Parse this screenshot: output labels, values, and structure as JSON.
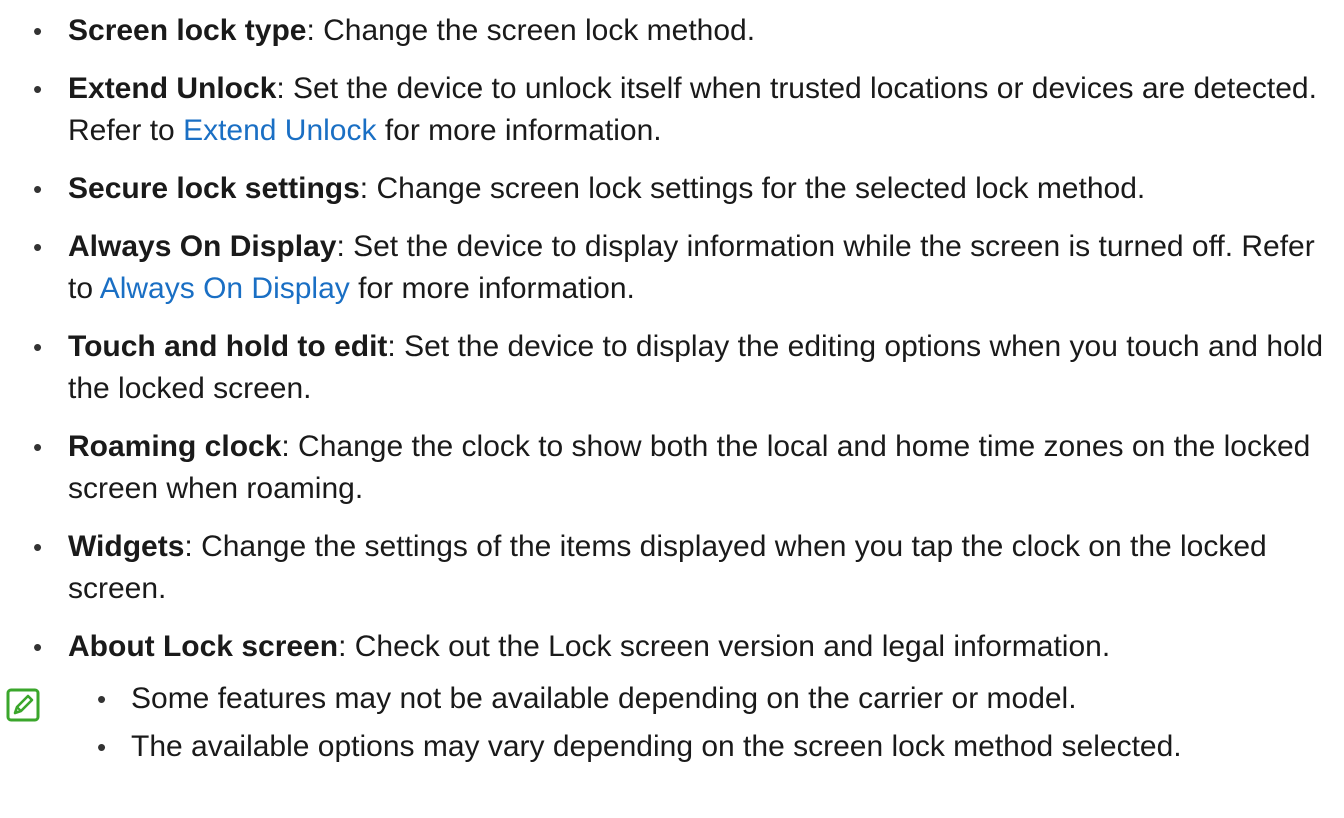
{
  "bullets": [
    {
      "term": "Screen lock type",
      "pre": ": Change the screen lock method.",
      "link": "",
      "post": ""
    },
    {
      "term": "Extend Unlock",
      "pre": ": Set the device to unlock itself when trusted locations or devices are detected. Refer to ",
      "link": "Extend Unlock",
      "post": " for more information."
    },
    {
      "term": "Secure lock settings",
      "pre": ": Change screen lock settings for the selected lock method.",
      "link": "",
      "post": ""
    },
    {
      "term": "Always On Display",
      "pre": ": Set the device to display information while the screen is turned off. Refer to ",
      "link": "Always On Display",
      "post": " for more information."
    },
    {
      "term": "Touch and hold to edit",
      "pre": ": Set the device to display the editing options when you touch and hold the locked screen.",
      "link": "",
      "post": ""
    },
    {
      "term": "Roaming clock",
      "pre": ": Change the clock to show both the local and home time zones on the locked screen when roaming.",
      "link": "",
      "post": ""
    },
    {
      "term": "Widgets",
      "pre": ": Change the settings of the items displayed when you tap the clock on the locked screen.",
      "link": "",
      "post": ""
    },
    {
      "term": "About Lock screen",
      "pre": ": Check out the Lock screen version and legal information.",
      "link": "",
      "post": ""
    }
  ],
  "notes": [
    "Some features may not be available depending on the carrier or model.",
    "The available options may vary depending on the screen lock method selected."
  ],
  "colors": {
    "link": "#1a6fc4",
    "note_icon": "#3aa62b"
  },
  "icons": {
    "note": "note-pencil-icon"
  }
}
